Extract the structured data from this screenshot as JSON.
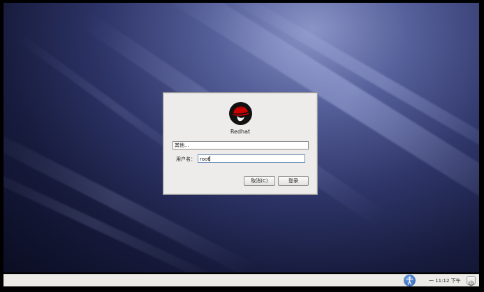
{
  "login_dialog": {
    "host_label": "Redhat",
    "other_user_option": "其他...",
    "username_label": "用户名：",
    "username_value": "root",
    "cancel_label": "取消(C)",
    "login_label": "登录",
    "logo_icon": "redhat-shadowman-icon"
  },
  "panel": {
    "accessibility_icon": "accessibility-icon",
    "clock_text": "一 11:12 下午",
    "power_icon": "power-icon"
  },
  "colors": {
    "dialog_bg": "#edecea",
    "panel_bg": "#ecebe8",
    "redhat_red": "#cc0000",
    "wallpaper_dark": "#0b0d22",
    "wallpaper_light": "#8a94c6"
  }
}
